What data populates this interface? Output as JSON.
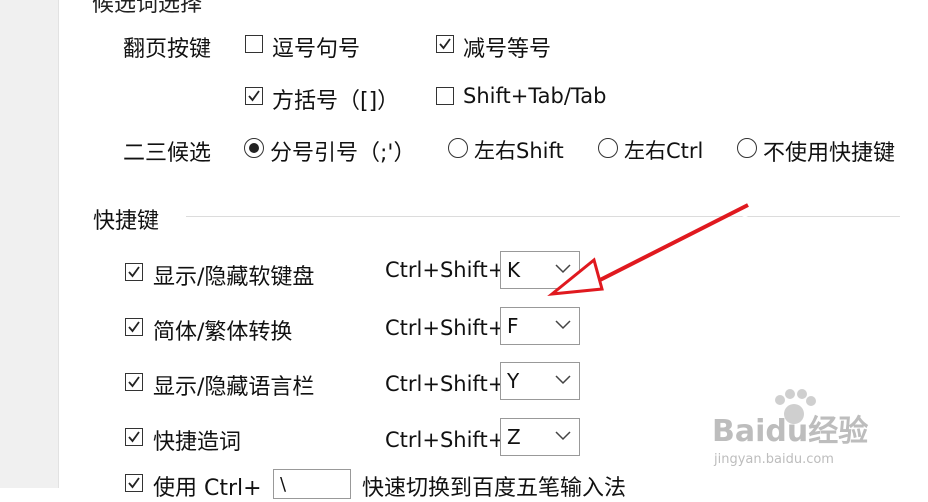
{
  "top": {
    "partial_title": "候选词选择"
  },
  "page_turn": {
    "label": "翻页按键",
    "options": [
      {
        "label": "逗号句号",
        "checked": false
      },
      {
        "label": "减号等号",
        "checked": true
      },
      {
        "label": "方括号（[]）",
        "checked": true
      },
      {
        "label": "Shift+Tab/Tab",
        "checked": false
      }
    ]
  },
  "second_third": {
    "label": "二三候选",
    "options": [
      {
        "label": "分号引号（;'）",
        "selected": true
      },
      {
        "label": "左右Shift",
        "selected": false
      },
      {
        "label": "左右Ctrl",
        "selected": false
      },
      {
        "label": "不使用快捷键",
        "selected": false
      }
    ]
  },
  "shortcuts": {
    "title": "快捷键",
    "prefix": "Ctrl+Shift+",
    "items": [
      {
        "label": "显示/隐藏软键盘",
        "checked": true,
        "key": "K"
      },
      {
        "label": "简体/繁体转换",
        "checked": true,
        "key": "F"
      },
      {
        "label": "显示/隐藏语言栏",
        "checked": true,
        "key": "Y"
      },
      {
        "label": "快捷造词",
        "checked": true,
        "key": "Z"
      }
    ],
    "partial_row": {
      "label_start": "使用 Ctrl+",
      "key": "\\",
      "label_end": "快速切换到百度五笔输入法"
    }
  },
  "watermark": {
    "brand": "Baidu经验",
    "url": "jingyan.baidu.com"
  },
  "colors": {
    "arrow": "#e0191f"
  }
}
